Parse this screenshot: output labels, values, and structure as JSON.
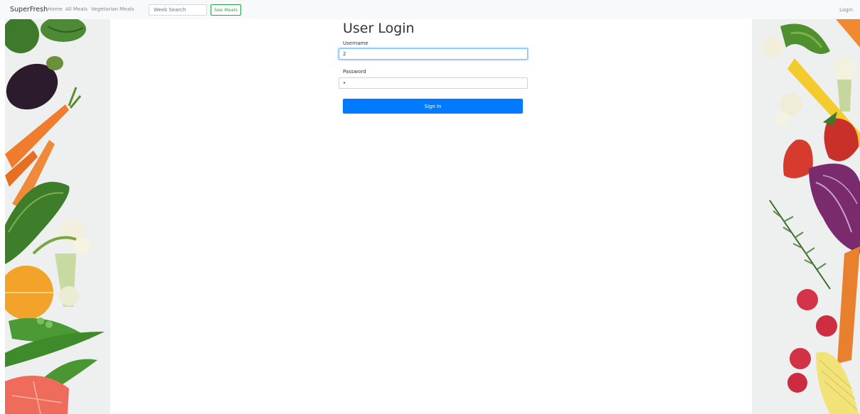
{
  "navbar": {
    "brand": "SuperFresh",
    "links": [
      "Home",
      "All Meals",
      "Vegetarian Meals"
    ],
    "search_placeholder": "Week Search",
    "search_button": "See Meals",
    "login": "Login"
  },
  "login_form": {
    "title": "User Login",
    "username_label": "Username",
    "username_value": "2",
    "password_label": "Password",
    "password_value": "•",
    "submit_label": "Sign In"
  },
  "colors": {
    "primary": "#007bff",
    "success": "#28a745",
    "navbar_bg": "#f8f9fa"
  }
}
